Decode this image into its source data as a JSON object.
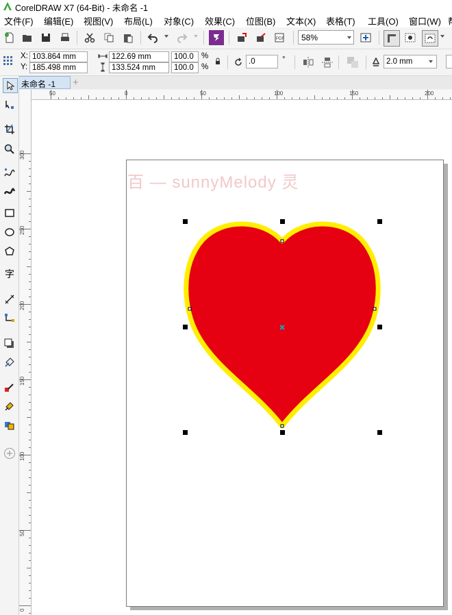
{
  "window": {
    "title": "CorelDRAW X7 (64-Bit) - 未命名 -1"
  },
  "menu": [
    "文件(F)",
    "编辑(E)",
    "视图(V)",
    "布局(L)",
    "对象(C)",
    "效果(C)",
    "位图(B)",
    "文本(X)",
    "表格(T)",
    "工具(O)",
    "窗口(W)",
    "帮"
  ],
  "toolbar": {
    "zoom_value": "58%",
    "icons": [
      "new-icon",
      "open-icon",
      "save-icon",
      "print-icon",
      "cut-icon",
      "copy-icon",
      "paste-icon",
      "undo-icon",
      "redo-icon",
      "launcher-icon",
      "import-icon",
      "export-icon",
      "publish-pdf-icon"
    ]
  },
  "properties": {
    "x_label": "X:",
    "x_value": "103.864 mm",
    "y_label": "Y:",
    "y_value": "185.498 mm",
    "width_value": "122.69 mm",
    "height_value": "133.524 mm",
    "scale_x": "100.0",
    "scale_y": "100.0",
    "percent": "%",
    "rotation_value": ".0",
    "degree": "°",
    "outline_width": "2.0 mm"
  },
  "document_tab": {
    "label": "未命名 -1",
    "add_label": "+"
  },
  "rulers": {
    "horizontal": [
      {
        "label": "50"
      },
      {
        "label": "0"
      },
      {
        "label": "50"
      },
      {
        "label": "100"
      },
      {
        "label": "150"
      },
      {
        "label": "200"
      }
    ],
    "vertical": [
      {
        "label": "300"
      },
      {
        "label": "250"
      },
      {
        "label": "200"
      },
      {
        "label": "150"
      },
      {
        "label": "100"
      },
      {
        "label": "50"
      },
      {
        "label": "0"
      }
    ]
  },
  "canvas": {
    "watermark": "百     — sunnyMelody 灵",
    "heart_fill": "#e50012",
    "heart_outline": "#ffee00"
  },
  "colors": {
    "accent": "#7b2c8f",
    "tab_active": "#d4e4f5"
  }
}
